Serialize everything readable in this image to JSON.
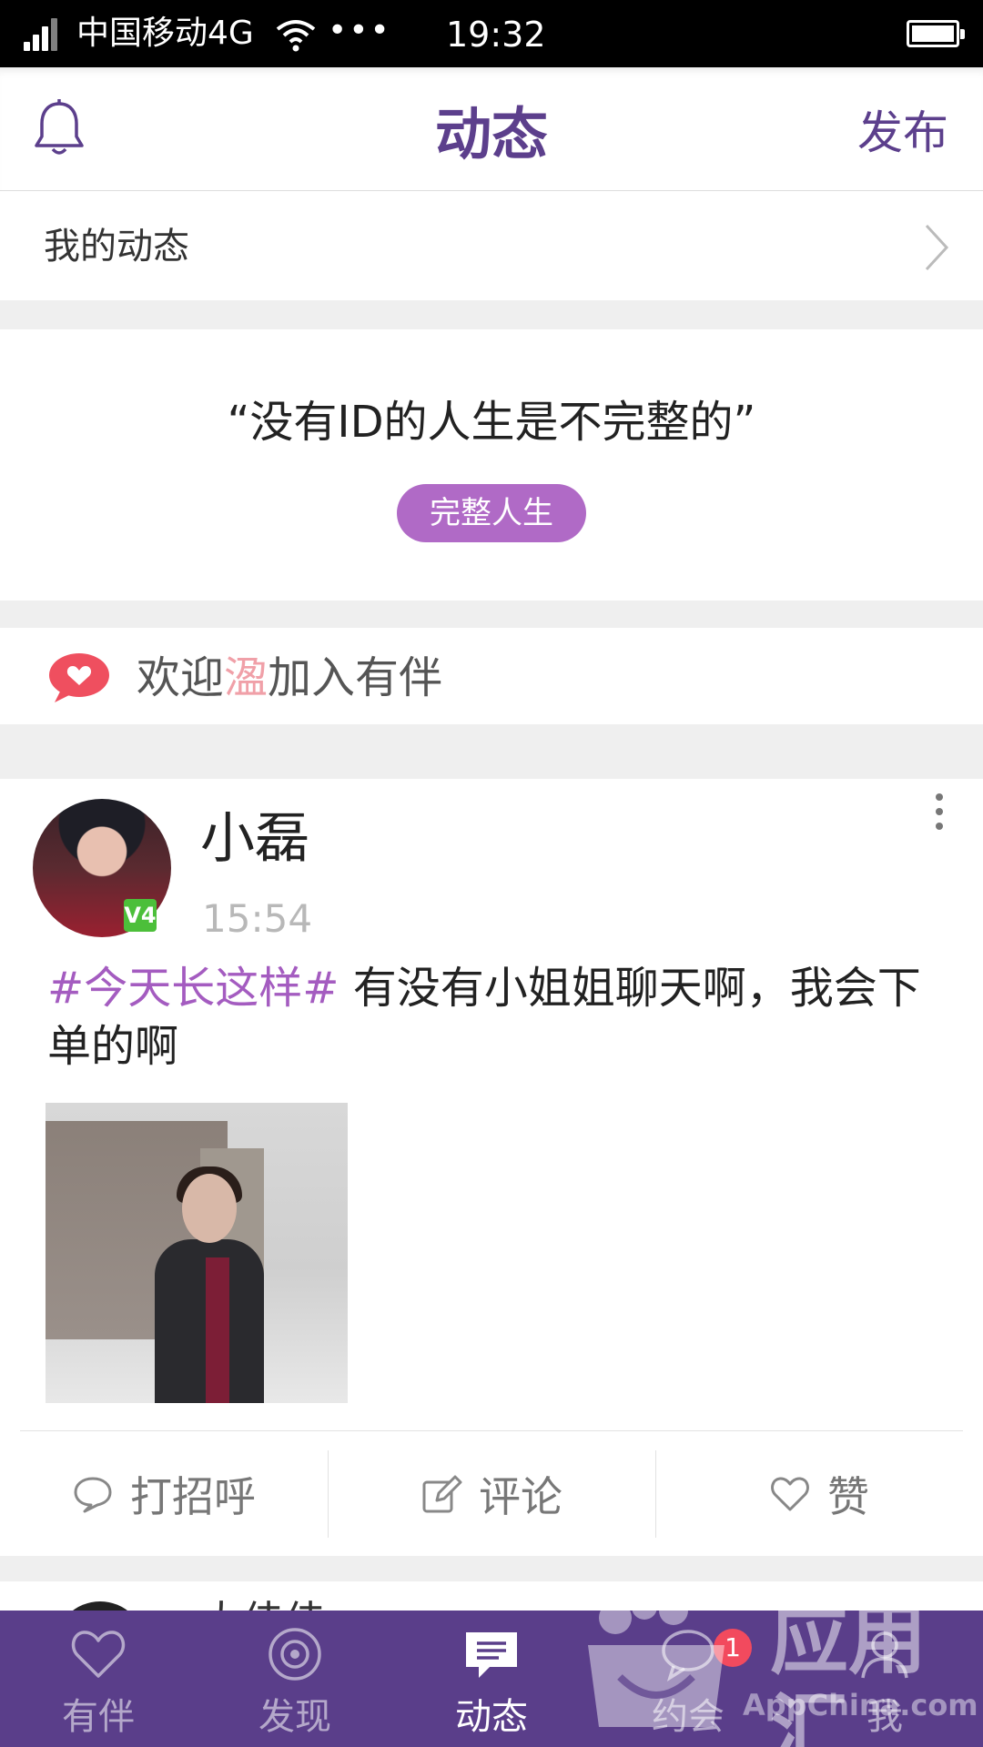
{
  "status_bar": {
    "carrier": "中国移动4G",
    "more": "•••",
    "time": "19:32"
  },
  "header": {
    "title": "动态",
    "publish_label": "发布"
  },
  "my_feed": {
    "label": "我的动态"
  },
  "promo": {
    "quote": "“没有ID的人生是不完整的”",
    "button_label": "完整人生"
  },
  "welcome": {
    "prefix": "欢迎",
    "name": "溋",
    "suffix": "加入有伴"
  },
  "post": {
    "author": "小磊",
    "time": "15:54",
    "badge": "V4",
    "tag": "#今天长这样#",
    "text": " 有没有小姐姐聊天啊，我会下单的啊",
    "actions": {
      "greet": "打招呼",
      "comment": "评论",
      "like": "赞"
    }
  },
  "post2": {
    "author_partial": "大佳佳"
  },
  "tabbar": {
    "tabs": [
      {
        "label": "有伴",
        "icon": "heart-icon"
      },
      {
        "label": "发现",
        "icon": "discover-icon"
      },
      {
        "label": "动态",
        "icon": "feed-message-icon"
      },
      {
        "label": "约会",
        "icon": "date-chat-icon"
      },
      {
        "label": "我",
        "icon": "profile-icon"
      }
    ],
    "active_index": 2,
    "badge_count": "1"
  },
  "watermark": {
    "text": "应用汇",
    "sub": "AppChina.com"
  },
  "colors": {
    "brand_purple": "#5c3f8c",
    "tabbar_bg": "#5a3e8a",
    "promo_button": "#b06ac6",
    "hashtag": "#a45cc0",
    "badge": "#f24a5e",
    "welcome_icon": "#ef4f5f"
  }
}
